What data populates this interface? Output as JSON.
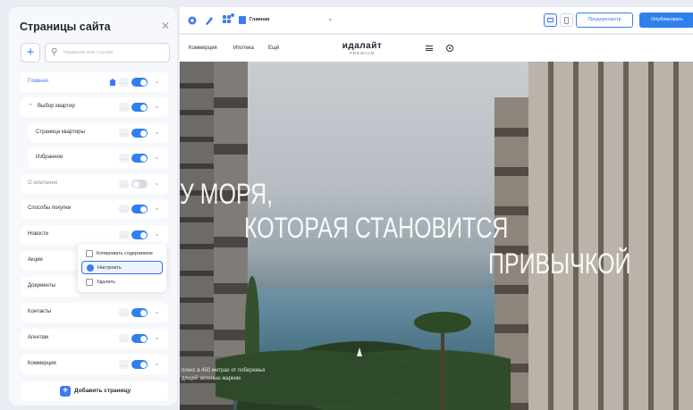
{
  "sidebar": {
    "title": "Страницы сайта",
    "search_placeholder": "Название или ссылка",
    "add_page_label": "Добавить страницу",
    "pages": [
      {
        "label": "Главная",
        "state": "active",
        "home": true,
        "enabled": true
      },
      {
        "label": "Выбор квартир",
        "state": "expanded",
        "enabled": true
      },
      {
        "label": "Страница квартиры",
        "state": "child",
        "enabled": true
      },
      {
        "label": "Избранное",
        "state": "child",
        "enabled": true
      },
      {
        "label": "О компании",
        "state": "muted",
        "enabled": false
      },
      {
        "label": "Способы покупки",
        "state": "normal",
        "enabled": true
      },
      {
        "label": "Новости",
        "state": "normal",
        "enabled": true
      },
      {
        "label": "Акции",
        "state": "normal",
        "enabled": true
      },
      {
        "label": "Документы",
        "state": "normal",
        "enabled": true
      },
      {
        "label": "Контакты",
        "state": "normal",
        "enabled": true
      },
      {
        "label": "Агентам",
        "state": "normal",
        "enabled": true
      },
      {
        "label": "Коммерция",
        "state": "normal",
        "enabled": true
      }
    ]
  },
  "context_menu": {
    "items": [
      {
        "label": "Копировать содержимое",
        "icon": "copy-icon"
      },
      {
        "label": "Настроить",
        "icon": "gear-icon",
        "highlighted": true
      },
      {
        "label": "Удалить",
        "icon": "trash-icon"
      }
    ]
  },
  "toolbar": {
    "current_page": "Главная",
    "preview_label": "Предпросмотр",
    "publish_label": "Опубликовать"
  },
  "site": {
    "nav": [
      "Коммерция",
      "Ипотека",
      "Ещё"
    ],
    "logo_main": "идалайт",
    "logo_sub": "PREMIUM",
    "hero_line1": "У МОРЯ,",
    "hero_line2": "КОТОРАЯ СТАНОВИТСЯ",
    "hero_line3": "ПРИВЫЧКОЙ",
    "hero_small_1": "плекс в 450 метрах от побережья",
    "hero_small_2": "дящей зеленью жарким"
  },
  "colors": {
    "accent": "#2f80ed",
    "panel_bg": "#f7f8fb",
    "page_bg": "#e9ecf3"
  }
}
